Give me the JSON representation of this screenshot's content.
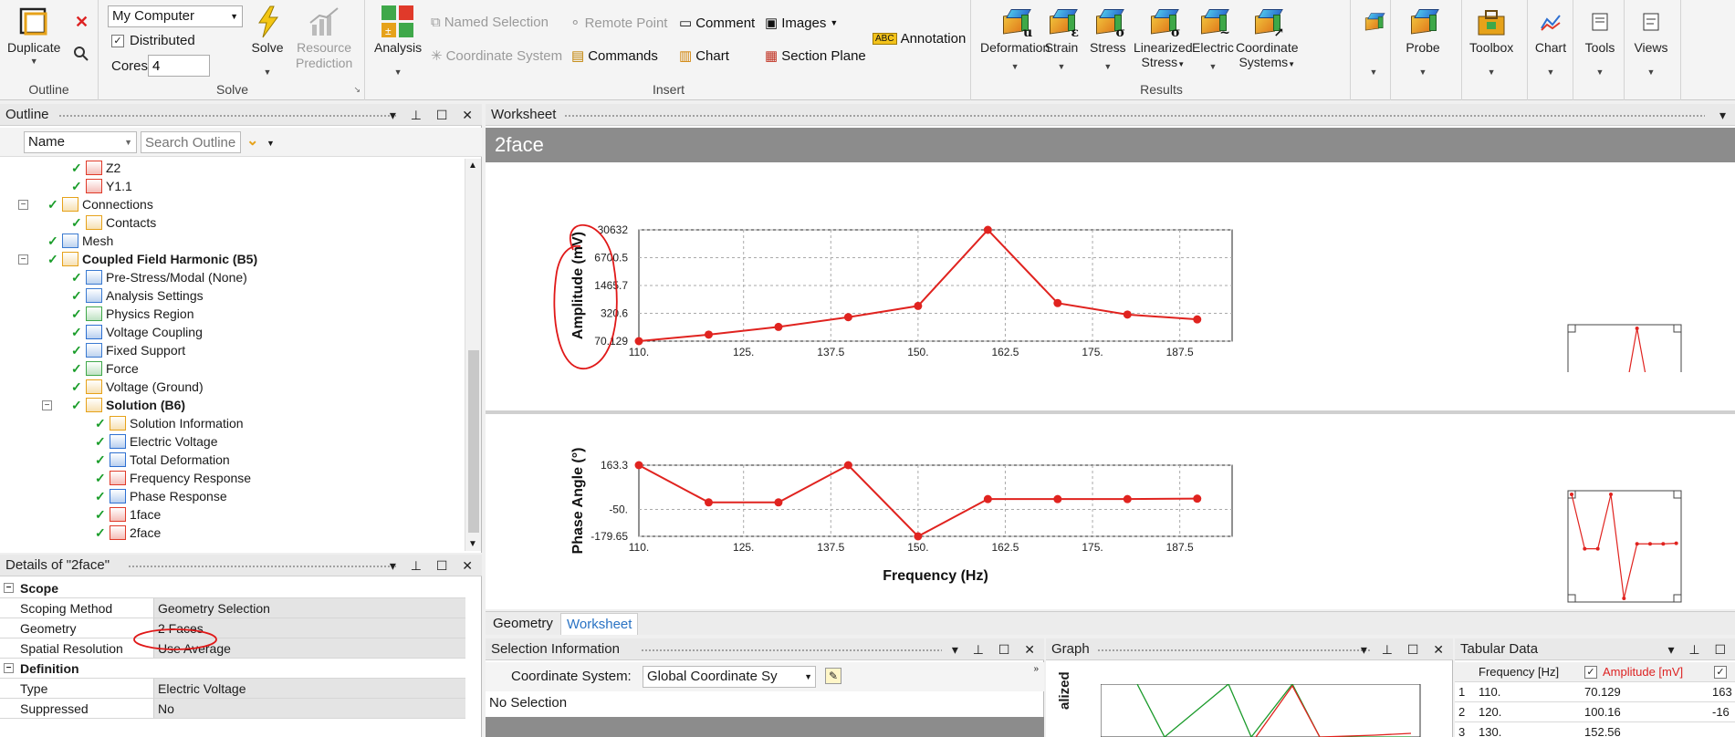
{
  "ribbon": {
    "outline_group": {
      "duplicate_label": "Duplicate",
      "group_label": "Outline"
    },
    "solve_group": {
      "computer_select": "My Computer",
      "distributed_label": "Distributed",
      "cores_label": "Cores",
      "cores_value": "4",
      "solve_label": "Solve",
      "resource_prediction_label": "Resource\nPrediction",
      "group_label": "Solve"
    },
    "insert_group": {
      "analysis_label": "Analysis",
      "named_selection": "Named Selection",
      "remote_point": "Remote Point",
      "comment": "Comment",
      "images": "Images",
      "coordinate_system": "Coordinate System",
      "commands": "Commands",
      "chart": "Chart",
      "section_plane": "Section Plane",
      "annotation": "Annotation",
      "group_label": "Insert"
    },
    "results_group": {
      "items": [
        {
          "label": "Deformation",
          "sym": "u"
        },
        {
          "label": "Strain",
          "sym": "ε"
        },
        {
          "label": "Stress",
          "sym": "σ"
        },
        {
          "label": "Linearized",
          "label2": "Stress",
          "sym": "σ"
        },
        {
          "label": "Electric",
          "sym": "~"
        },
        {
          "label": "Coordinate",
          "label2": "Systems",
          "sym": "↗"
        }
      ],
      "group_label": "Results"
    },
    "tools": {
      "probe": "Probe",
      "toolbox": "Toolbox",
      "chart": "Chart",
      "tools": "Tools",
      "views": "Views"
    }
  },
  "outline": {
    "title": "Outline",
    "name_select": "Name",
    "search_placeholder": "Search Outline",
    "tree": [
      {
        "label": "Z2",
        "indent": 3
      },
      {
        "label": "Y1.1",
        "indent": 3
      },
      {
        "label": "Connections",
        "indent": 2
      },
      {
        "label": "Contacts",
        "indent": 3
      },
      {
        "label": "Mesh",
        "indent": 2
      },
      {
        "label": "Coupled Field Harmonic (B5)",
        "indent": 2,
        "bold": true
      },
      {
        "label": "Pre-Stress/Modal (None)",
        "indent": 3
      },
      {
        "label": "Analysis Settings",
        "indent": 3
      },
      {
        "label": "Physics Region",
        "indent": 3
      },
      {
        "label": "Voltage Coupling",
        "indent": 3
      },
      {
        "label": "Fixed Support",
        "indent": 3
      },
      {
        "label": "Force",
        "indent": 3
      },
      {
        "label": "Voltage (Ground)",
        "indent": 3
      },
      {
        "label": "Solution (B6)",
        "indent": 3,
        "bold": true
      },
      {
        "label": "Solution Information",
        "indent": 4
      },
      {
        "label": "Electric Voltage",
        "indent": 4
      },
      {
        "label": "Total Deformation",
        "indent": 4
      },
      {
        "label": "Frequency Response",
        "indent": 4
      },
      {
        "label": "Phase Response",
        "indent": 4
      },
      {
        "label": "1face",
        "indent": 4
      },
      {
        "label": "2face",
        "indent": 4,
        "selected": true
      }
    ]
  },
  "details": {
    "title": "Details of \"2face\"",
    "rows": [
      {
        "section": "Scope"
      },
      {
        "key": "Scoping Method",
        "value": "Geometry Selection"
      },
      {
        "key": "Geometry",
        "value": "2 Faces"
      },
      {
        "key": "Spatial Resolution",
        "value": "Use Average"
      },
      {
        "section": "Definition"
      },
      {
        "key": "Type",
        "value": "Electric Voltage"
      },
      {
        "key": "Suppressed",
        "value": "No"
      }
    ]
  },
  "worksheet": {
    "title": "Worksheet",
    "header": "2face",
    "tabs": [
      "Geometry",
      "Worksheet"
    ],
    "active_tab": "Worksheet"
  },
  "selection_info": {
    "title": "Selection Information",
    "coord_label": "Coordinate System:",
    "coord_value": "Global Coordinate Sy",
    "status": "No Selection"
  },
  "graph": {
    "title": "Graph",
    "ylabel_fragment": "alized"
  },
  "tabular": {
    "title": "Tabular Data",
    "headers": [
      "Frequency [Hz]",
      "Amplitude [mV]"
    ],
    "rows": [
      {
        "i": "1",
        "freq": "110.",
        "amp": "70.129",
        "extra": "163"
      },
      {
        "i": "2",
        "freq": "120.",
        "amp": "100.16",
        "extra": "-16"
      },
      {
        "i": "3",
        "freq": "130.",
        "amp": "152.56",
        "extra": ""
      }
    ]
  },
  "chart_data": [
    {
      "type": "line",
      "xlabel": "Frequency (Hz)",
      "ylabel": "Amplitude (mV)",
      "yscale": "log",
      "xlim": [
        110,
        195
      ],
      "x_ticks": [
        "110.",
        "125.",
        "137.5",
        "150.",
        "162.5",
        "175.",
        "187.5"
      ],
      "y_ticks": [
        "70.129",
        "320.6",
        "1465.7",
        "6700.5",
        "30632"
      ],
      "x": [
        110,
        120,
        130,
        140,
        150,
        160,
        170,
        180,
        190
      ],
      "series": [
        {
          "values": [
            70.129,
            100.16,
            152.56,
            260,
            480,
            30632,
            560,
            300,
            230
          ]
        }
      ],
      "color": "#e0231f"
    },
    {
      "type": "line",
      "xlabel": "Frequency (Hz)",
      "ylabel": "Phase Angle (°)",
      "xlim": [
        110,
        195
      ],
      "ylim": [
        -179.65,
        163.3
      ],
      "x_ticks": [
        "110.",
        "125.",
        "137.5",
        "150.",
        "162.5",
        "175.",
        "187.5"
      ],
      "y_ticks": [
        "163.3",
        "-50.",
        "-179.65"
      ],
      "x": [
        110,
        120,
        130,
        140,
        150,
        160,
        170,
        180,
        190
      ],
      "series": [
        {
          "values": [
            163.3,
            -16,
            -16,
            163.3,
            -179.65,
            0,
            0,
            0,
            2
          ]
        }
      ],
      "color": "#e0231f"
    }
  ]
}
